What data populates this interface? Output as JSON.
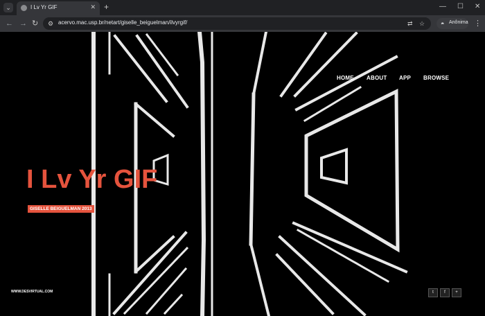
{
  "browser": {
    "tab_title": "I Lv Yr GIF",
    "tab_close": "✕",
    "new_tab": "+",
    "url": "acervo.mac.usp.br/netart/giselle_beiguelman/ilvyrgif/",
    "profile_label": "Anônima",
    "window_controls": {
      "minimize": "—",
      "maximize": "☐",
      "close": "✕"
    },
    "nav": {
      "back": "←",
      "forward": "→",
      "reload": "↻"
    }
  },
  "site": {
    "nav": [
      {
        "label": "HOME"
      },
      {
        "label": "ABOUT"
      },
      {
        "label": "APP"
      },
      {
        "label": "BROWSE"
      }
    ],
    "title": "I Lv Yr GIF",
    "author": "GISELLE BEIGUELMAN 2013",
    "footer_link": "WWW.DESVIRTUAL.COM",
    "social": [
      {
        "icon": "twitter-icon",
        "glyph": "t"
      },
      {
        "icon": "facebook-icon",
        "glyph": "f"
      },
      {
        "icon": "google-plus-icon",
        "glyph": "+"
      }
    ],
    "colors": {
      "accent": "#e5533d",
      "background": "#000000",
      "art": "#e8e8e8"
    }
  }
}
